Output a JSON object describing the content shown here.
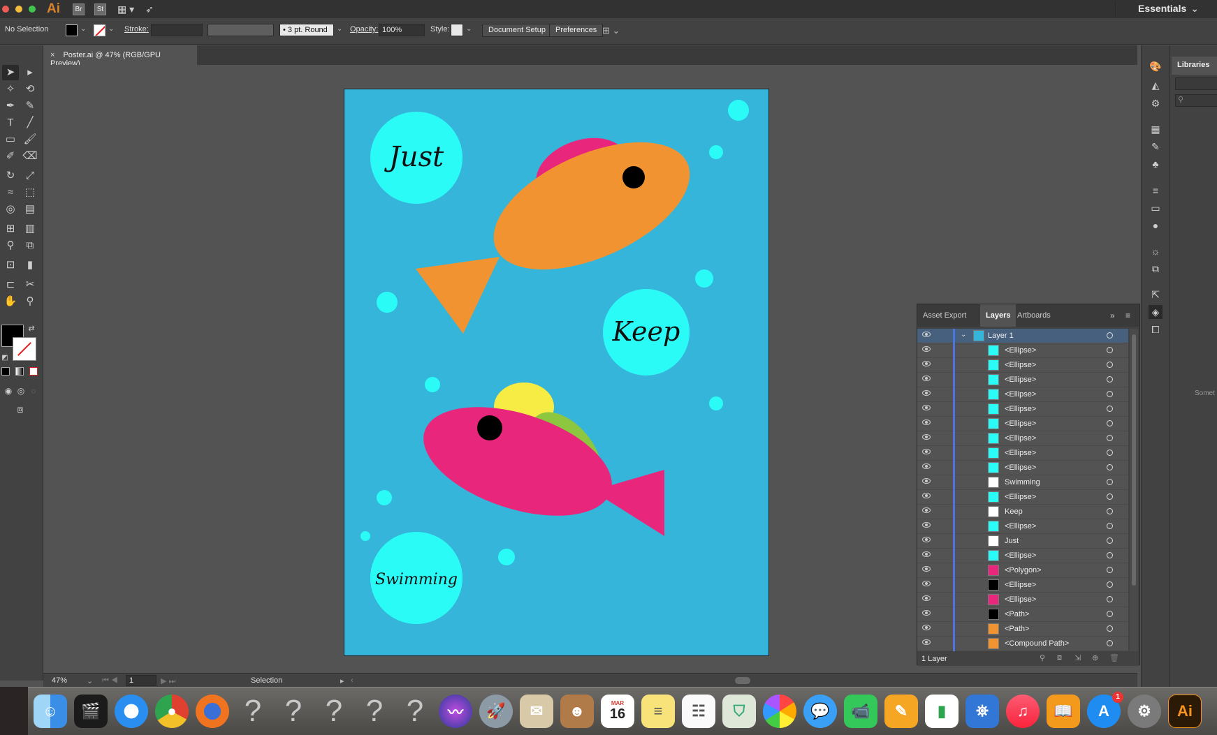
{
  "app": {
    "logo": "Ai",
    "bridge": "Br",
    "stock": "St",
    "workspace": "Essentials",
    "traffic_colors": [
      "#ee5b54",
      "#f4bd3c",
      "#41c64d"
    ]
  },
  "control_bar": {
    "selection": "No Selection",
    "stroke_label": "Stroke:",
    "brush": "3 pt. Round",
    "opacity_label": "Opacity:",
    "opacity_value": "100%",
    "style_label": "Style:",
    "document_setup": "Document Setup",
    "preferences": "Preferences"
  },
  "document_tab": {
    "close": "×",
    "title": "Poster.ai @ 47% (RGB/GPU Preview)"
  },
  "artboard": {
    "background": "#35b5da",
    "texts": [
      "Just",
      "Keep",
      "Swimming"
    ],
    "colors": {
      "bubble": "#2bfbf7",
      "orange_fish": "#f29331",
      "pink": "#e8267b",
      "green": "#3cb14a",
      "yellow": "#f6ec43",
      "lime": "#8dc63f",
      "eye": "#000000"
    }
  },
  "status_bar": {
    "zoom": "47%",
    "artboard_number": "1",
    "tool": "Selection"
  },
  "layers_panel": {
    "tabs": [
      "Asset Export",
      "Layers",
      "Artboards"
    ],
    "active_tab": "Layers",
    "layer": "Layer 1",
    "items": [
      {
        "name": "<Ellipse>",
        "thumb": "#2bfbf7"
      },
      {
        "name": "<Ellipse>",
        "thumb": "#2bfbf7"
      },
      {
        "name": "<Ellipse>",
        "thumb": "#2bfbf7"
      },
      {
        "name": "<Ellipse>",
        "thumb": "#2bfbf7"
      },
      {
        "name": "<Ellipse>",
        "thumb": "#2bfbf7"
      },
      {
        "name": "<Ellipse>",
        "thumb": "#2bfbf7"
      },
      {
        "name": "<Ellipse>",
        "thumb": "#2bfbf7"
      },
      {
        "name": "<Ellipse>",
        "thumb": "#2bfbf7"
      },
      {
        "name": "<Ellipse>",
        "thumb": "#2bfbf7"
      },
      {
        "name": "Swimming",
        "thumb": "#ffffff"
      },
      {
        "name": "<Ellipse>",
        "thumb": "#2bfbf7"
      },
      {
        "name": "Keep",
        "thumb": "#ffffff"
      },
      {
        "name": "<Ellipse>",
        "thumb": "#2bfbf7"
      },
      {
        "name": "Just",
        "thumb": "#ffffff"
      },
      {
        "name": "<Ellipse>",
        "thumb": "#2bfbf7"
      },
      {
        "name": "<Polygon>",
        "thumb": "#e8267b"
      },
      {
        "name": "<Ellipse>",
        "thumb": "#000000"
      },
      {
        "name": "<Ellipse>",
        "thumb": "#e8267b"
      },
      {
        "name": "<Path>",
        "thumb": "#000000"
      },
      {
        "name": "<Path>",
        "thumb": "#f29331"
      },
      {
        "name": "<Compound Path>",
        "thumb": "#f29331"
      }
    ],
    "footer": "1 Layer"
  },
  "libraries": {
    "tab": "Libraries",
    "side_note": "Somet"
  },
  "dock": {
    "calendar_month": "MAR",
    "calendar_day": "16",
    "question": "?",
    "appstore_badge": "1",
    "illustrator": "Ai"
  }
}
